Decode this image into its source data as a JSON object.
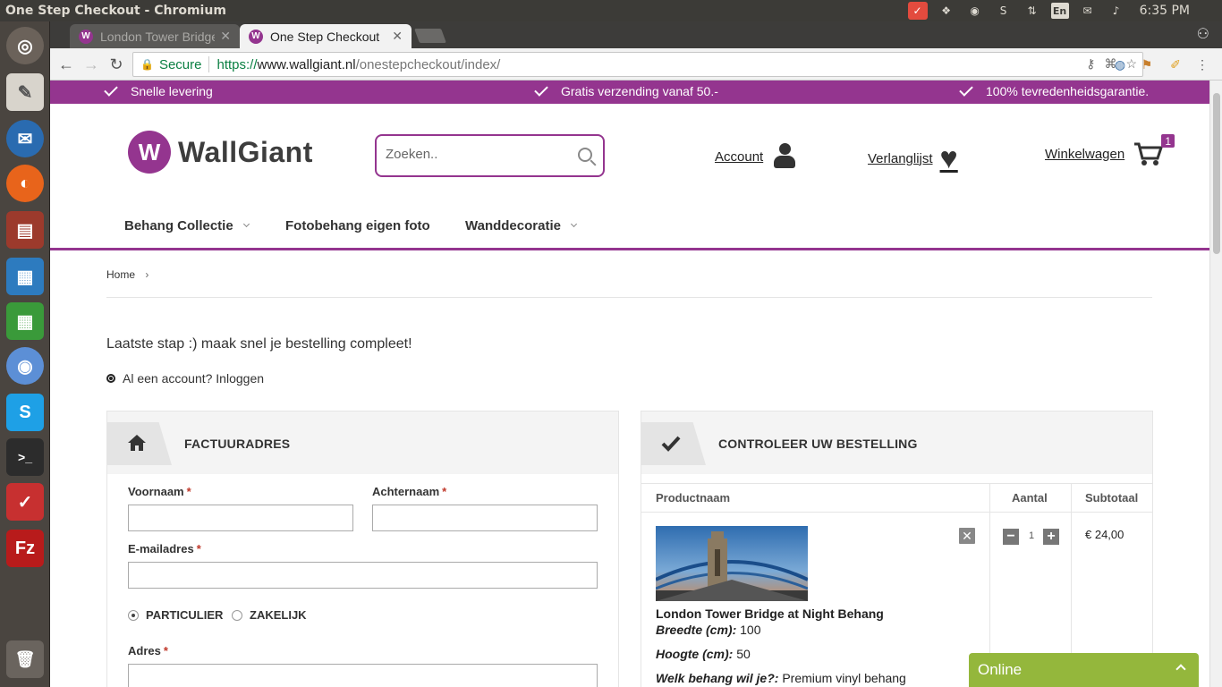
{
  "os": {
    "window_title": "One Step Checkout - Chromium",
    "keyboard": "En",
    "clock": "6:35 PM"
  },
  "browser": {
    "tabs": [
      {
        "label": "London Tower Bridge",
        "active": false
      },
      {
        "label": "One Step Checkout",
        "active": true
      }
    ],
    "secure_label": "Secure",
    "url_scheme": "https://",
    "url_host": "www.wallgiant.nl",
    "url_path": "/onestepcheckout/index/"
  },
  "promo": [
    "Snelle levering",
    "Gratis verzending vanaf 50.-",
    "100% tevredenheidsgarantie."
  ],
  "header": {
    "logo_text": "WallGiant",
    "search_placeholder": "Zoeken..",
    "account": "Account",
    "wishlist": "Verlanglijst",
    "cart": "Winkelwagen",
    "cart_count": "1"
  },
  "nav": [
    {
      "label": "Behang Collectie",
      "dropdown": true
    },
    {
      "label": "Fotobehang eigen foto",
      "dropdown": false
    },
    {
      "label": "Wanddecoratie",
      "dropdown": true
    }
  ],
  "breadcrumb": {
    "home": "Home",
    "sep": "›"
  },
  "intro": "Laatste stap :) maak snel je bestelling compleet!",
  "login_link": "Al een account? Inloggen",
  "billing": {
    "title": "FACTUURADRES",
    "firstname_label": "Voornaam",
    "lastname_label": "Achternaam",
    "email_label": "E-mailadres",
    "required_mark": "*",
    "radio_private": "PARTICULIER",
    "radio_business": "ZAKELIJK",
    "address_label": "Adres"
  },
  "review": {
    "title": "CONTROLEER UW BESTELLING",
    "col_product": "Productnaam",
    "col_qty": "Aantal",
    "col_subtotal": "Subtotaal",
    "item": {
      "name": "London Tower Bridge at Night Behang",
      "width_label": "Breedte (cm):",
      "width_value": "100",
      "height_label": "Hoogte (cm):",
      "height_value": "50",
      "type_label": "Welk behang wil je?:",
      "type_value": "Premium vinyl behang",
      "qty": "1",
      "subtotal": "€ 24,00"
    }
  },
  "chat": {
    "label": "Online"
  },
  "colors": {
    "brand": "#94358f",
    "chat": "#94b73c"
  }
}
